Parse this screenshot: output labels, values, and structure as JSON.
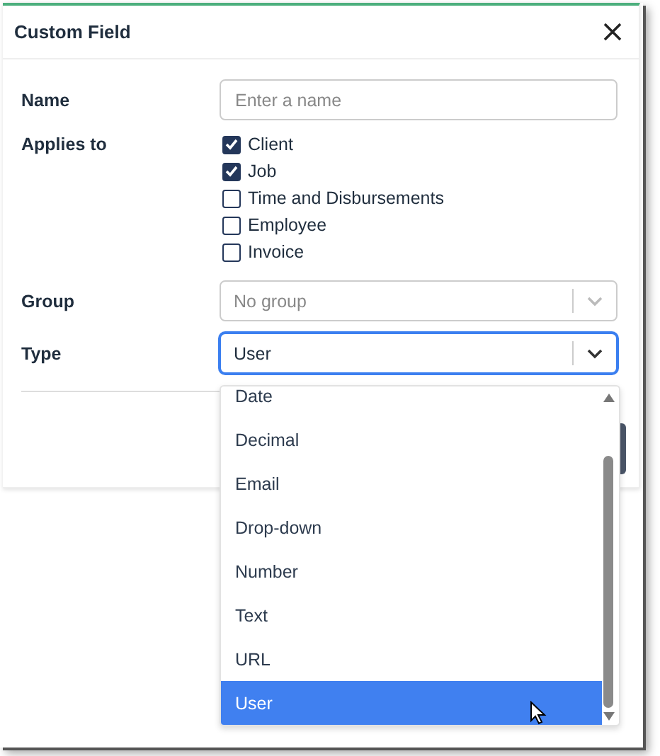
{
  "dialog": {
    "title": "Custom Field"
  },
  "name_field": {
    "label": "Name",
    "placeholder": "Enter a name"
  },
  "applies_to": {
    "label": "Applies to",
    "options": [
      {
        "label": "Client",
        "checked": true
      },
      {
        "label": "Job",
        "checked": true
      },
      {
        "label": "Time and Disbursements",
        "checked": false
      },
      {
        "label": "Employee",
        "checked": false
      },
      {
        "label": "Invoice",
        "checked": false
      }
    ]
  },
  "group_field": {
    "label": "Group",
    "placeholder": "No group"
  },
  "type_field": {
    "label": "Type",
    "value": "User",
    "expanded": true,
    "options": [
      {
        "label": "Date",
        "selected": false
      },
      {
        "label": "Decimal",
        "selected": false
      },
      {
        "label": "Email",
        "selected": false
      },
      {
        "label": "Drop-down",
        "selected": false
      },
      {
        "label": "Number",
        "selected": false
      },
      {
        "label": "Text",
        "selected": false
      },
      {
        "label": "URL",
        "selected": false
      },
      {
        "label": "User",
        "selected": true
      }
    ]
  }
}
